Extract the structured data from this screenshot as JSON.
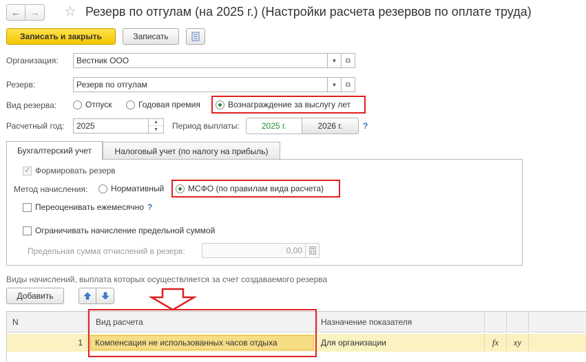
{
  "header": {
    "back_icon": "arrow-left-icon",
    "forward_icon": "arrow-right-icon",
    "favorite_icon": "star-icon",
    "title": "Резерв по отгулам (на 2025 г.) (Настройки расчета резервов по оплате труда)"
  },
  "toolbar": {
    "save_close_label": "Записать и закрыть",
    "save_label": "Записать",
    "document_icon": "document-list-icon"
  },
  "form": {
    "organization_label": "Организация:",
    "organization_value": "Вестник ООО",
    "reserve_label": "Резерв:",
    "reserve_value": "Резерв по отгулам",
    "reserve_type_label": "Вид резерва:",
    "reserve_type_options": [
      "Отпуск",
      "Годовая премия",
      "Вознаграждение за выслугу лет"
    ],
    "reserve_type_selected": 2,
    "calc_year_label": "Расчетный год:",
    "calc_year_value": "2025",
    "payment_period_label": "Период выплаты:",
    "payment_period_options": [
      "2025 г.",
      "2026 г."
    ],
    "payment_period_selected": 0,
    "help_mark": "?"
  },
  "tabs": [
    {
      "label": "Бухгалтерский учет",
      "active": true
    },
    {
      "label": "Налоговый учет (по налогу на прибыль)",
      "active": false
    }
  ],
  "accounting": {
    "form_reserve_label": "Формировать резерв",
    "form_reserve_checked": true,
    "method_label": "Метод начисления:",
    "method_options": [
      "Нормативный",
      "МСФО (по правилам вида расчета)"
    ],
    "method_selected": 1,
    "revalue_label": "Переоценивать ежемесячно",
    "revalue_help": "?",
    "limit_label": "Ограничивать начисление предельной суммой",
    "limit_sum_label": "Предельная сумма отчислений в резерв:",
    "limit_sum_value": "0,00",
    "calculator_icon": "calculator-icon"
  },
  "accruals": {
    "section_label": "Виды начислений, выплата которых осуществляется за счет создаваемого резерва",
    "add_label": "Добавить",
    "move_up_icon": "arrow-up-icon",
    "move_down_icon": "arrow-down-icon",
    "annotation_icon": "arrow-down-outline-icon",
    "columns": [
      "N",
      "Вид расчета",
      "Назначение показателя"
    ],
    "formula_icon_label": "fx",
    "xy_icon_label": "xy",
    "rows": [
      {
        "n": "1",
        "calc_type": "Компенсация не использованных часов отдыха",
        "purpose": "Для организации"
      }
    ]
  }
}
